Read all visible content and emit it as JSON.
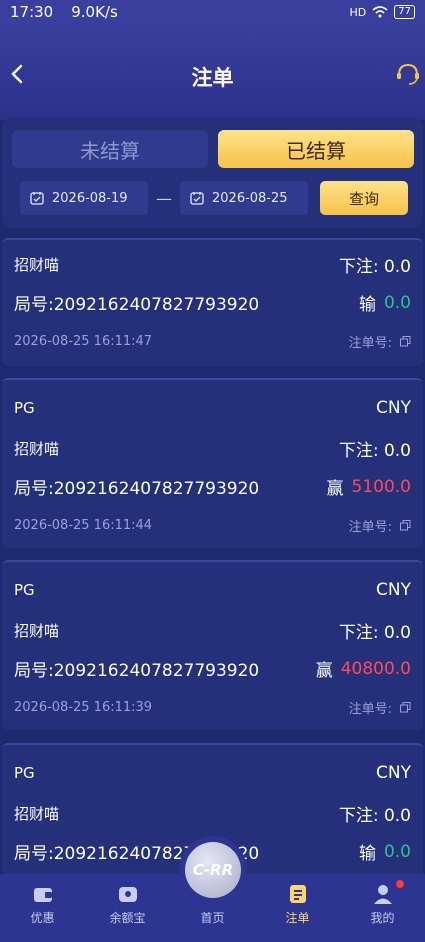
{
  "status": {
    "time": "17:30",
    "speed": "9.0K/s",
    "network": "HD",
    "battery": "77"
  },
  "header": {
    "title": "注单"
  },
  "tabs": {
    "unsettled": "未结算",
    "settled": "已结算"
  },
  "filter": {
    "start_date": "2026-08-19",
    "separator": "—",
    "end_date": "2026-08-25",
    "query_label": "查询"
  },
  "cards": [
    {
      "provider": "",
      "currency": "",
      "game": "招财喵",
      "bet_label": "下注: 0.0",
      "round": "局号:2092162407827793920",
      "result_label": "输",
      "amount": "0.0",
      "time": "2026-08-25 16:11:47",
      "order_label": "注单号:"
    },
    {
      "provider": "PG",
      "currency": "CNY",
      "game": "招财喵",
      "bet_label": "下注: 0.0",
      "round": "局号:2092162407827793920",
      "result_label": "赢",
      "amount": "5100.0",
      "time": "2026-08-25 16:11:44",
      "order_label": "注单号:"
    },
    {
      "provider": "PG",
      "currency": "CNY",
      "game": "招财喵",
      "bet_label": "下注: 0.0",
      "round": "局号:2092162407827793920",
      "result_label": "赢",
      "amount": "40800.0",
      "time": "2026-08-25 16:11:39",
      "order_label": "注单号:"
    },
    {
      "provider": "PG",
      "currency": "CNY",
      "game": "招财喵",
      "bet_label": "下注: 0.0",
      "round": "局号:2092162407827793920",
      "result_label": "输",
      "amount": "0.0"
    }
  ],
  "nav": {
    "promo": "优惠",
    "balance": "余额宝",
    "home": "首页",
    "orders": "注单",
    "mine": "我的",
    "center_logo": "C-RR"
  },
  "colors": {
    "accent": "#f6c24a",
    "win": "#ff4b55",
    "lose": "#2fc28b",
    "bg": "#1e2a6e"
  }
}
